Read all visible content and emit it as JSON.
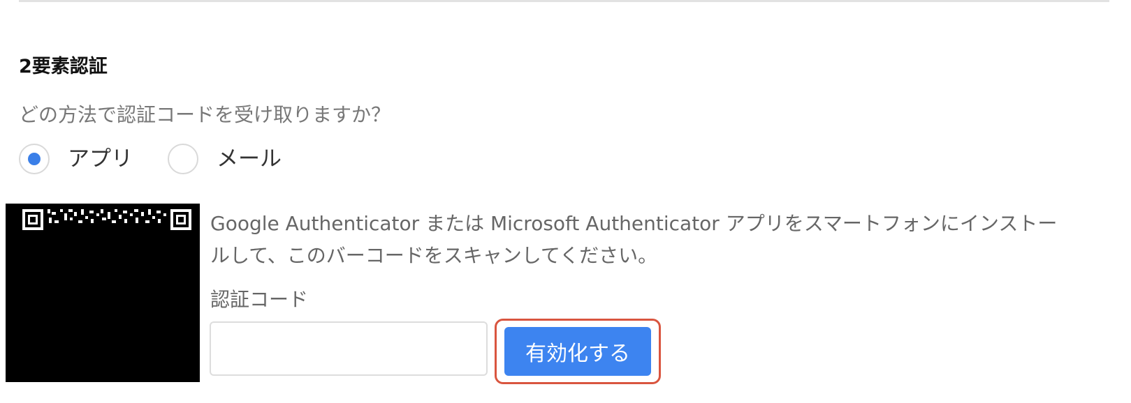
{
  "section": {
    "title": "2要素認証"
  },
  "auth_method": {
    "question": "どの方法で認証コードを受け取りますか？",
    "options": [
      {
        "label": "アプリ",
        "selected": true
      },
      {
        "label": "メール",
        "selected": false
      }
    ]
  },
  "setup": {
    "qr_icon": "qr-code-icon",
    "instruction": "Google Authenticator または Microsoft Authenticator アプリをスマートフォンにインストールして、このバーコードをスキャンしてください。",
    "code_label": "認証コード",
    "code_value": "",
    "code_placeholder": "",
    "activate_label": "有効化する"
  },
  "colors": {
    "accent": "#3d84f0",
    "highlight": "#d9553f"
  }
}
